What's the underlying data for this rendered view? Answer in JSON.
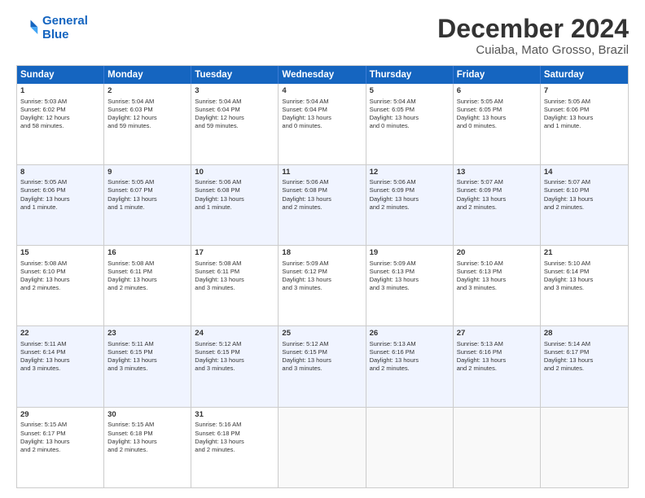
{
  "logo": {
    "line1": "General",
    "line2": "Blue"
  },
  "title": "December 2024",
  "subtitle": "Cuiaba, Mato Grosso, Brazil",
  "days": [
    "Sunday",
    "Monday",
    "Tuesday",
    "Wednesday",
    "Thursday",
    "Friday",
    "Saturday"
  ],
  "rows": [
    [
      {
        "day": "1",
        "lines": [
          "Sunrise: 5:03 AM",
          "Sunset: 6:02 PM",
          "Daylight: 12 hours",
          "and 58 minutes."
        ]
      },
      {
        "day": "2",
        "lines": [
          "Sunrise: 5:04 AM",
          "Sunset: 6:03 PM",
          "Daylight: 12 hours",
          "and 59 minutes."
        ]
      },
      {
        "day": "3",
        "lines": [
          "Sunrise: 5:04 AM",
          "Sunset: 6:04 PM",
          "Daylight: 12 hours",
          "and 59 minutes."
        ]
      },
      {
        "day": "4",
        "lines": [
          "Sunrise: 5:04 AM",
          "Sunset: 6:04 PM",
          "Daylight: 13 hours",
          "and 0 minutes."
        ]
      },
      {
        "day": "5",
        "lines": [
          "Sunrise: 5:04 AM",
          "Sunset: 6:05 PM",
          "Daylight: 13 hours",
          "and 0 minutes."
        ]
      },
      {
        "day": "6",
        "lines": [
          "Sunrise: 5:05 AM",
          "Sunset: 6:05 PM",
          "Daylight: 13 hours",
          "and 0 minutes."
        ]
      },
      {
        "day": "7",
        "lines": [
          "Sunrise: 5:05 AM",
          "Sunset: 6:06 PM",
          "Daylight: 13 hours",
          "and 1 minute."
        ]
      }
    ],
    [
      {
        "day": "8",
        "lines": [
          "Sunrise: 5:05 AM",
          "Sunset: 6:06 PM",
          "Daylight: 13 hours",
          "and 1 minute."
        ]
      },
      {
        "day": "9",
        "lines": [
          "Sunrise: 5:05 AM",
          "Sunset: 6:07 PM",
          "Daylight: 13 hours",
          "and 1 minute."
        ]
      },
      {
        "day": "10",
        "lines": [
          "Sunrise: 5:06 AM",
          "Sunset: 6:08 PM",
          "Daylight: 13 hours",
          "and 1 minute."
        ]
      },
      {
        "day": "11",
        "lines": [
          "Sunrise: 5:06 AM",
          "Sunset: 6:08 PM",
          "Daylight: 13 hours",
          "and 2 minutes."
        ]
      },
      {
        "day": "12",
        "lines": [
          "Sunrise: 5:06 AM",
          "Sunset: 6:09 PM",
          "Daylight: 13 hours",
          "and 2 minutes."
        ]
      },
      {
        "day": "13",
        "lines": [
          "Sunrise: 5:07 AM",
          "Sunset: 6:09 PM",
          "Daylight: 13 hours",
          "and 2 minutes."
        ]
      },
      {
        "day": "14",
        "lines": [
          "Sunrise: 5:07 AM",
          "Sunset: 6:10 PM",
          "Daylight: 13 hours",
          "and 2 minutes."
        ]
      }
    ],
    [
      {
        "day": "15",
        "lines": [
          "Sunrise: 5:08 AM",
          "Sunset: 6:10 PM",
          "Daylight: 13 hours",
          "and 2 minutes."
        ]
      },
      {
        "day": "16",
        "lines": [
          "Sunrise: 5:08 AM",
          "Sunset: 6:11 PM",
          "Daylight: 13 hours",
          "and 2 minutes."
        ]
      },
      {
        "day": "17",
        "lines": [
          "Sunrise: 5:08 AM",
          "Sunset: 6:11 PM",
          "Daylight: 13 hours",
          "and 3 minutes."
        ]
      },
      {
        "day": "18",
        "lines": [
          "Sunrise: 5:09 AM",
          "Sunset: 6:12 PM",
          "Daylight: 13 hours",
          "and 3 minutes."
        ]
      },
      {
        "day": "19",
        "lines": [
          "Sunrise: 5:09 AM",
          "Sunset: 6:13 PM",
          "Daylight: 13 hours",
          "and 3 minutes."
        ]
      },
      {
        "day": "20",
        "lines": [
          "Sunrise: 5:10 AM",
          "Sunset: 6:13 PM",
          "Daylight: 13 hours",
          "and 3 minutes."
        ]
      },
      {
        "day": "21",
        "lines": [
          "Sunrise: 5:10 AM",
          "Sunset: 6:14 PM",
          "Daylight: 13 hours",
          "and 3 minutes."
        ]
      }
    ],
    [
      {
        "day": "22",
        "lines": [
          "Sunrise: 5:11 AM",
          "Sunset: 6:14 PM",
          "Daylight: 13 hours",
          "and 3 minutes."
        ]
      },
      {
        "day": "23",
        "lines": [
          "Sunrise: 5:11 AM",
          "Sunset: 6:15 PM",
          "Daylight: 13 hours",
          "and 3 minutes."
        ]
      },
      {
        "day": "24",
        "lines": [
          "Sunrise: 5:12 AM",
          "Sunset: 6:15 PM",
          "Daylight: 13 hours",
          "and 3 minutes."
        ]
      },
      {
        "day": "25",
        "lines": [
          "Sunrise: 5:12 AM",
          "Sunset: 6:15 PM",
          "Daylight: 13 hours",
          "and 3 minutes."
        ]
      },
      {
        "day": "26",
        "lines": [
          "Sunrise: 5:13 AM",
          "Sunset: 6:16 PM",
          "Daylight: 13 hours",
          "and 2 minutes."
        ]
      },
      {
        "day": "27",
        "lines": [
          "Sunrise: 5:13 AM",
          "Sunset: 6:16 PM",
          "Daylight: 13 hours",
          "and 2 minutes."
        ]
      },
      {
        "day": "28",
        "lines": [
          "Sunrise: 5:14 AM",
          "Sunset: 6:17 PM",
          "Daylight: 13 hours",
          "and 2 minutes."
        ]
      }
    ],
    [
      {
        "day": "29",
        "lines": [
          "Sunrise: 5:15 AM",
          "Sunset: 6:17 PM",
          "Daylight: 13 hours",
          "and 2 minutes."
        ]
      },
      {
        "day": "30",
        "lines": [
          "Sunrise: 5:15 AM",
          "Sunset: 6:18 PM",
          "Daylight: 13 hours",
          "and 2 minutes."
        ]
      },
      {
        "day": "31",
        "lines": [
          "Sunrise: 5:16 AM",
          "Sunset: 6:18 PM",
          "Daylight: 13 hours",
          "and 2 minutes."
        ]
      },
      {
        "day": "",
        "lines": []
      },
      {
        "day": "",
        "lines": []
      },
      {
        "day": "",
        "lines": []
      },
      {
        "day": "",
        "lines": []
      }
    ]
  ]
}
